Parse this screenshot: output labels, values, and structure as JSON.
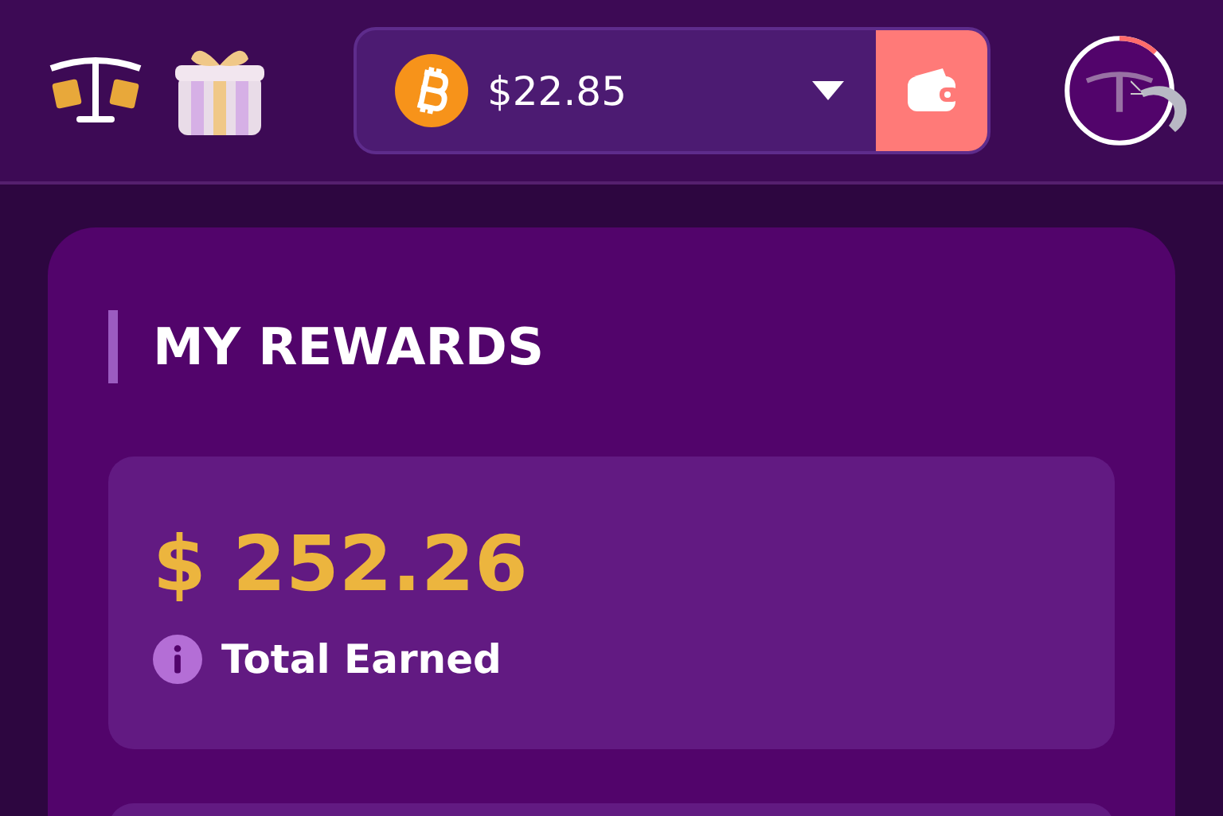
{
  "header": {
    "balance": {
      "amount": "$22.85"
    },
    "avatar": {
      "level": 0.12
    }
  },
  "rewards": {
    "title": "MY REWARDS",
    "total": {
      "amount": "$ 252.26",
      "label": "Total Earned"
    }
  }
}
